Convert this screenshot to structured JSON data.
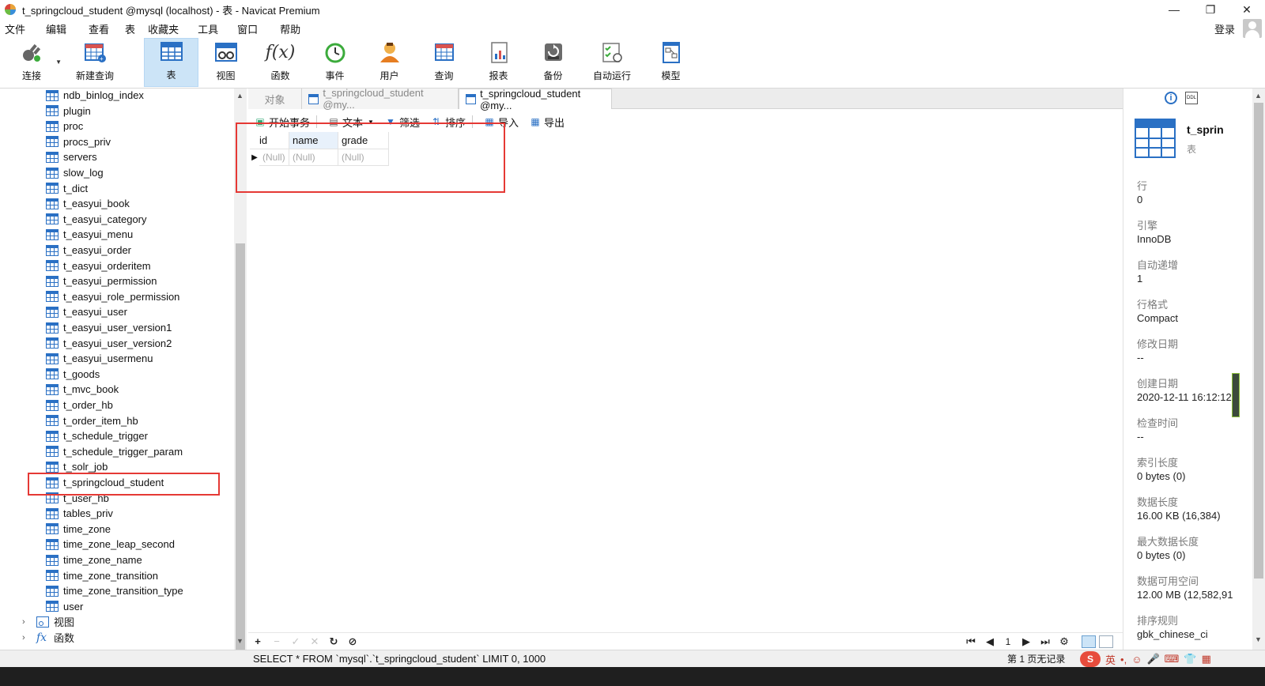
{
  "window": {
    "title": "t_springcloud_student @mysql (localhost) - 表 - Navicat Premium",
    "controls": [
      "—",
      "❐",
      "✕"
    ]
  },
  "menu": [
    "文件",
    "编辑",
    "查看",
    "表",
    "收藏夹",
    "工具",
    "窗口",
    "帮助"
  ],
  "login_label": "登录",
  "toolbar": [
    {
      "label": "连接",
      "icon": "plug-icon"
    },
    {
      "label": "新建查询",
      "icon": "new-query-icon"
    },
    {
      "label": "表",
      "icon": "table-icon",
      "active": true
    },
    {
      "label": "视图",
      "icon": "view-icon"
    },
    {
      "label": "函数",
      "icon": "function-icon"
    },
    {
      "label": "事件",
      "icon": "event-clock-icon"
    },
    {
      "label": "用户",
      "icon": "user-icon"
    },
    {
      "label": "查询",
      "icon": "query-icon"
    },
    {
      "label": "报表",
      "icon": "report-icon"
    },
    {
      "label": "备份",
      "icon": "backup-icon"
    },
    {
      "label": "自动运行",
      "icon": "auto-run-icon"
    },
    {
      "label": "模型",
      "icon": "model-icon"
    }
  ],
  "tree": {
    "tables": [
      "ndb_binlog_index",
      "plugin",
      "proc",
      "procs_priv",
      "servers",
      "slow_log",
      "t_dict",
      "t_easyui_book",
      "t_easyui_category",
      "t_easyui_menu",
      "t_easyui_order",
      "t_easyui_orderitem",
      "t_easyui_permission",
      "t_easyui_role_permission",
      "t_easyui_user",
      "t_easyui_user_version1",
      "t_easyui_user_version2",
      "t_easyui_usermenu",
      "t_goods",
      "t_mvc_book",
      "t_order_hb",
      "t_order_item_hb",
      "t_schedule_trigger",
      "t_schedule_trigger_param",
      "t_solr_job",
      "t_springcloud_student",
      "t_user_hb",
      "tables_priv",
      "time_zone",
      "time_zone_leap_second",
      "time_zone_name",
      "time_zone_transition",
      "time_zone_transition_type",
      "user"
    ],
    "highlighted": "t_springcloud_student",
    "groups": [
      {
        "label": "视图",
        "icon": "view-group-icon"
      },
      {
        "label": "函数",
        "icon": "function-group-icon"
      }
    ]
  },
  "tabs": [
    {
      "label": "对象"
    },
    {
      "label": "t_springcloud_student @my..."
    },
    {
      "label": "t_springcloud_student @my...",
      "active": true
    }
  ],
  "subtoolbar": [
    "开始事务",
    "文本",
    "筛选",
    "排序",
    "导入",
    "导出"
  ],
  "grid": {
    "columns": [
      "id",
      "name",
      "grade"
    ],
    "rows": [
      [
        "(Null)",
        "(Null)",
        "(Null)"
      ]
    ]
  },
  "nav": {
    "page": "1"
  },
  "status": {
    "sql": "SELECT * FROM `mysql`.`t_springcloud_student` LIMIT 0, 1000",
    "records": "第 1 页无记录",
    "ime_label": "英"
  },
  "info": {
    "name": "t_sprin",
    "type": "表",
    "props": [
      {
        "label": "行",
        "value": "0"
      },
      {
        "label": "引擎",
        "value": "InnoDB"
      },
      {
        "label": "自动递增",
        "value": "1"
      },
      {
        "label": "行格式",
        "value": "Compact"
      },
      {
        "label": "修改日期",
        "value": "--"
      },
      {
        "label": "创建日期",
        "value": "2020-12-11 16:12:12"
      },
      {
        "label": "检查时间",
        "value": "--"
      },
      {
        "label": "索引长度",
        "value": "0 bytes (0)"
      },
      {
        "label": "数据长度",
        "value": "16.00 KB (16,384)"
      },
      {
        "label": "最大数据长度",
        "value": "0 bytes (0)"
      },
      {
        "label": "数据可用空间",
        "value": "12.00 MB (12,582,91"
      },
      {
        "label": "排序规则",
        "value": "gbk_chinese_ci"
      }
    ]
  },
  "colors": {
    "accent": "#2a70c4",
    "highlight_box": "#e53935",
    "active_tool": "#cce4f7"
  }
}
